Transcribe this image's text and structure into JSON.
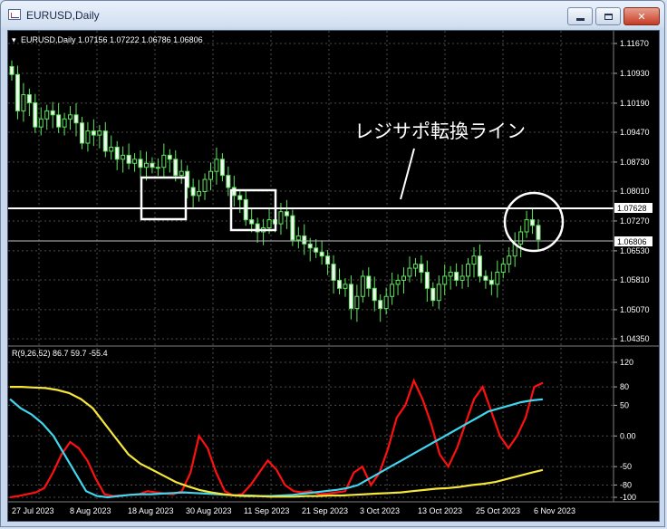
{
  "window": {
    "title": "EURUSD,Daily",
    "minimize_icon": "minimize-icon",
    "maximize_icon": "maximize-icon",
    "close_icon": "close-icon"
  },
  "colors": {
    "background": "#000000",
    "grid": "#4d4d4d",
    "candle": "#5ee65e",
    "resistance_line": "#ffffff",
    "r_line": "#ff1010",
    "cyan_line": "#40d6ee",
    "yellow_line": "#f5e63a",
    "axis_text": "#ffffff"
  },
  "chart": {
    "header": "EURUSD,Daily  1.07156 1.07222 1.06786 1.06806",
    "annotation": "レジサポ転換ライン",
    "price_ticks": [
      "1.11670",
      "1.10930",
      "1.10190",
      "1.09470",
      "1.08730",
      "1.08010",
      "1.07270",
      "1.06530",
      "1.05810",
      "1.05070",
      "1.04350"
    ],
    "level_label": "1.07628",
    "current_label": "1.06806",
    "date_ticks": [
      "27 Jul 2023",
      "8 Aug 2023",
      "18 Aug 2023",
      "30 Aug 2023",
      "11 Sep 2023",
      "21 Sep 2023",
      "3 Oct 2023",
      "13 Oct 2023",
      "25 Oct 2023",
      "6 Nov 2023"
    ]
  },
  "indicator": {
    "header": "R(9,26,52) 86.7 59.7 -55.4",
    "ticks": [
      "120",
      "80",
      "50",
      "0.00",
      "-50",
      "-80",
      "-100"
    ]
  },
  "chart_data": {
    "type": "line",
    "title": "EURUSD,Daily",
    "y_range": [
      1.0435,
      1.1167
    ],
    "level": 1.07628,
    "current": 1.06806,
    "ohlc_last": {
      "open": 1.07156,
      "high": 1.07222,
      "low": 1.06786,
      "close": 1.06806
    },
    "close_series": [
      1.109,
      1.1,
      1.104,
      1.102,
      1.096,
      1.098,
      1.1,
      1.099,
      1.096,
      1.098,
      1.099,
      1.097,
      1.092,
      1.095,
      1.094,
      1.095,
      1.09,
      1.091,
      1.088,
      1.089,
      1.087,
      1.088,
      1.086,
      1.087,
      1.086,
      1.086,
      1.089,
      1.088,
      1.084,
      1.085,
      1.081,
      1.079,
      1.08,
      1.083,
      1.085,
      1.088,
      1.084,
      1.081,
      1.079,
      1.078,
      1.073,
      1.072,
      1.07,
      1.071,
      1.073,
      1.072,
      1.075,
      1.074,
      1.068,
      1.069,
      1.067,
      1.066,
      1.065,
      1.064,
      1.062,
      1.058,
      1.056,
      1.057,
      1.051,
      1.054,
      1.059,
      1.056,
      1.053,
      1.051,
      1.054,
      1.057,
      1.058,
      1.059,
      1.061,
      1.062,
      1.06,
      1.056,
      1.053,
      1.057,
      1.059,
      1.06,
      1.058,
      1.059,
      1.062,
      1.064,
      1.059,
      1.058,
      1.057,
      1.06,
      1.062,
      1.064,
      1.067,
      1.07,
      1.073,
      1.0716,
      1.0681
    ],
    "indicator_series": [
      {
        "name": "R",
        "range": [
          -100,
          120
        ],
        "values": [
          -100,
          -98,
          -95,
          -92,
          -85,
          -60,
          -30,
          -10,
          -20,
          -40,
          -70,
          -95,
          -98,
          -97,
          -96,
          -95,
          -90,
          -92,
          -94,
          -95,
          -90,
          -60,
          0,
          -20,
          -60,
          -90,
          -97,
          -95,
          -80,
          -60,
          -40,
          -55,
          -80,
          -90,
          -92,
          -90,
          -95,
          -94,
          -92,
          -90,
          -60,
          -50,
          -80,
          -60,
          -20,
          30,
          50,
          90,
          60,
          20,
          -30,
          -50,
          -20,
          20,
          60,
          80,
          40,
          0,
          -20,
          0,
          30,
          80,
          86.7
        ]
      },
      {
        "name": "",
        "range": [
          -100,
          120
        ],
        "values": [
          60,
          45,
          35,
          20,
          0,
          -30,
          -60,
          -90,
          -98,
          -100,
          -98,
          -96,
          -95,
          -95,
          -94,
          -93,
          -92,
          -93,
          -94,
          -95,
          -96,
          -97,
          -97,
          -98,
          -98,
          -97,
          -96,
          -94,
          -92,
          -90,
          -88,
          -85,
          -80,
          -70,
          -60,
          -50,
          -40,
          -30,
          -20,
          -10,
          0,
          10,
          20,
          30,
          40,
          45,
          50,
          55,
          58,
          59.7
        ]
      },
      {
        "name": "",
        "range": [
          -100,
          120
        ],
        "values": [
          80,
          80,
          79,
          78,
          75,
          70,
          60,
          45,
          20,
          -5,
          -30,
          -45,
          -55,
          -65,
          -75,
          -82,
          -88,
          -92,
          -95,
          -97,
          -98,
          -98,
          -99,
          -99,
          -99,
          -98,
          -98,
          -97,
          -97,
          -96,
          -95,
          -94,
          -93,
          -92,
          -90,
          -88,
          -86,
          -85,
          -83,
          -80,
          -78,
          -75,
          -70,
          -65,
          -60,
          -55.4
        ]
      }
    ]
  }
}
